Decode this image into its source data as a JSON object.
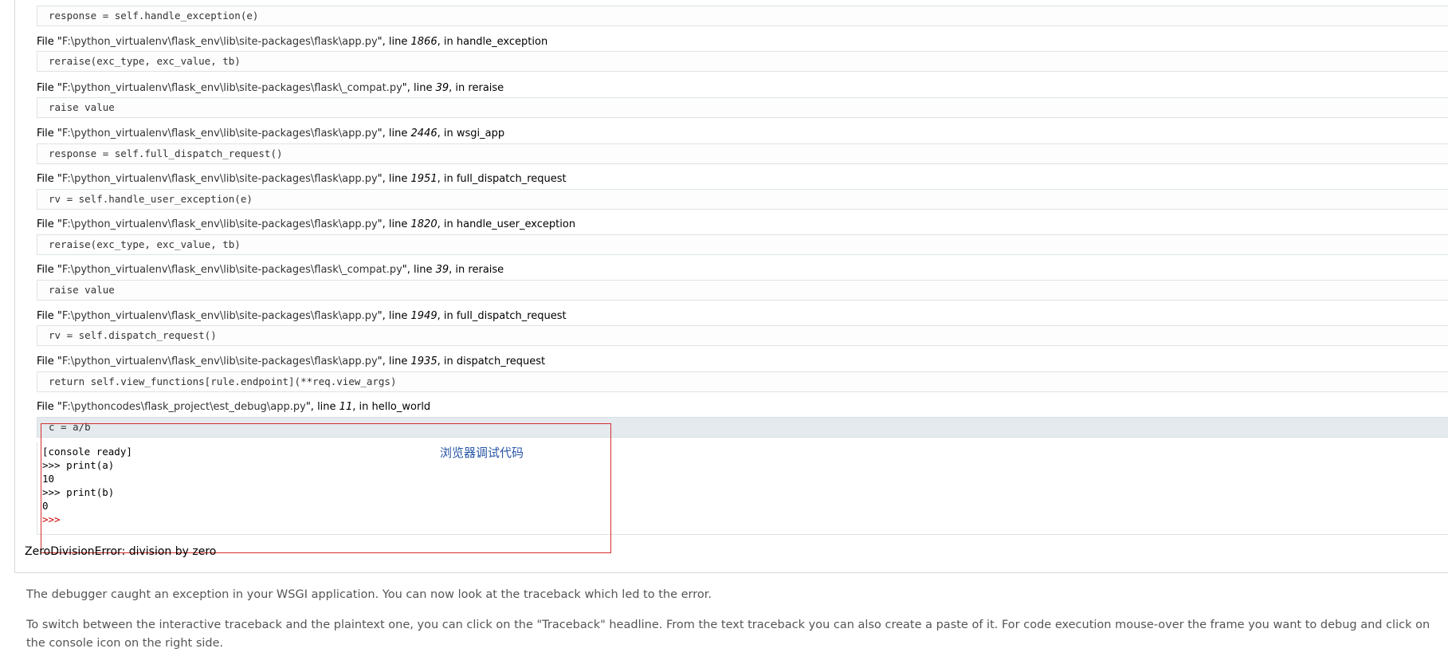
{
  "frames": [
    {
      "file_prefix": "File \"",
      "path": "F:\\python_virtualenv\\flask_env\\lib\\site-packages\\flask\\app.py",
      "line_label": "\", line ",
      "lineno": "1866",
      "in_label": ", in ",
      "func": "handle_exception",
      "code": "reraise(exc_type, exc_value, tb)"
    },
    {
      "file_prefix": "File \"",
      "path": "F:\\python_virtualenv\\flask_env\\lib\\site-packages\\flask\\_compat.py",
      "line_label": "\", line ",
      "lineno": "39",
      "in_label": ", in ",
      "func": "reraise",
      "code": "raise value"
    },
    {
      "file_prefix": "File \"",
      "path": "F:\\python_virtualenv\\flask_env\\lib\\site-packages\\flask\\app.py",
      "line_label": "\", line ",
      "lineno": "2446",
      "in_label": ", in ",
      "func": "wsgi_app",
      "code": "response = self.full_dispatch_request()"
    },
    {
      "file_prefix": "File \"",
      "path": "F:\\python_virtualenv\\flask_env\\lib\\site-packages\\flask\\app.py",
      "line_label": "\", line ",
      "lineno": "1951",
      "in_label": ", in ",
      "func": "full_dispatch_request",
      "code": "rv = self.handle_user_exception(e)"
    },
    {
      "file_prefix": "File \"",
      "path": "F:\\python_virtualenv\\flask_env\\lib\\site-packages\\flask\\app.py",
      "line_label": "\", line ",
      "lineno": "1820",
      "in_label": ", in ",
      "func": "handle_user_exception",
      "code": "reraise(exc_type, exc_value, tb)"
    },
    {
      "file_prefix": "File \"",
      "path": "F:\\python_virtualenv\\flask_env\\lib\\site-packages\\flask\\_compat.py",
      "line_label": "\", line ",
      "lineno": "39",
      "in_label": ", in ",
      "func": "reraise",
      "code": "raise value"
    },
    {
      "file_prefix": "File \"",
      "path": "F:\\python_virtualenv\\flask_env\\lib\\site-packages\\flask\\app.py",
      "line_label": "\", line ",
      "lineno": "1949",
      "in_label": ", in ",
      "func": "full_dispatch_request",
      "code": "rv = self.dispatch_request()"
    },
    {
      "file_prefix": "File \"",
      "path": "F:\\python_virtualenv\\flask_env\\lib\\site-packages\\flask\\app.py",
      "line_label": "\", line ",
      "lineno": "1935",
      "in_label": ", in ",
      "func": "dispatch_request",
      "code": "return self.view_functions[rule.endpoint](**req.view_args)"
    },
    {
      "file_prefix": "File \"",
      "path": "F:\\pythoncodes\\flask_project\\est_debug\\app.py",
      "line_label": "\", line ",
      "lineno": "11",
      "in_label": ", in ",
      "func": "hello_world",
      "code": "c = a/b"
    }
  ],
  "top_code": "response = self.handle_exception(e)",
  "console": {
    "lines": [
      "[console ready]",
      ">>> print(a)",
      "10",
      ">>> print(b)",
      "0",
      ">>>"
    ]
  },
  "annotation": "浏览器调试代码",
  "error_message": "ZeroDivisionError: division by zero",
  "explanation": {
    "p1": "The debugger caught an exception in your WSGI application. You can now look at the traceback which led to the error.",
    "p2": "To switch between the interactive traceback and the plaintext one, you can click on the \"Traceback\" headline. From the text traceback you can also create a paste of it. For code execution mouse-over the frame you want to debug and click on the console icon on the right side."
  },
  "colors": {
    "annotation_border": "#d32f2f",
    "annotation_text": "#2a57a6",
    "current_line_bg": "#e4eaee"
  }
}
